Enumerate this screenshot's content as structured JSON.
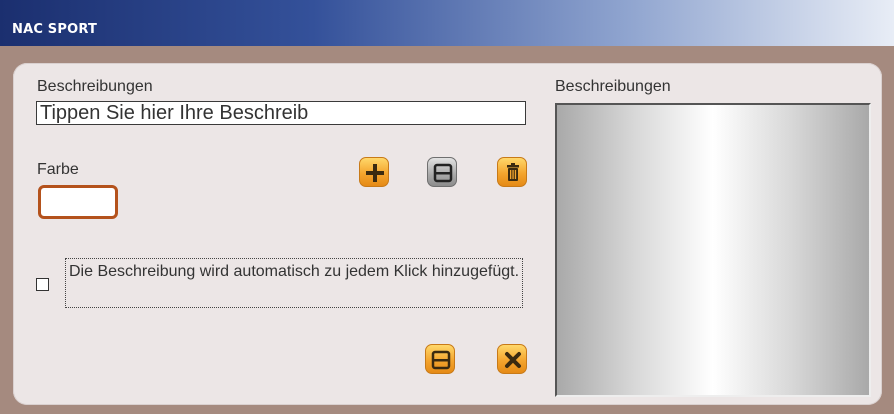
{
  "window": {
    "title": "NAC SPORT"
  },
  "form": {
    "description_label": "Beschreibungen",
    "description_placeholder": "Tippen Sie hier Ihre Beschreib",
    "description_value": "",
    "color_label": "Farbe",
    "auto_add_text": "Die Beschreibung wird automatisch zu jedem Klick hinzugefügt.",
    "auto_add_checked": false
  },
  "list": {
    "label": "Beschreibungen",
    "items": []
  },
  "icons": {
    "add": "plus-icon",
    "save_top": "save-icon",
    "delete": "trash-icon",
    "save": "save-icon",
    "close": "close-icon"
  },
  "colors": {
    "accent": "#f4a52e",
    "frame": "#a58a7f",
    "panel": "#ece6e6",
    "color_border": "#b4521c",
    "titlebar": "#1b2f6f"
  }
}
